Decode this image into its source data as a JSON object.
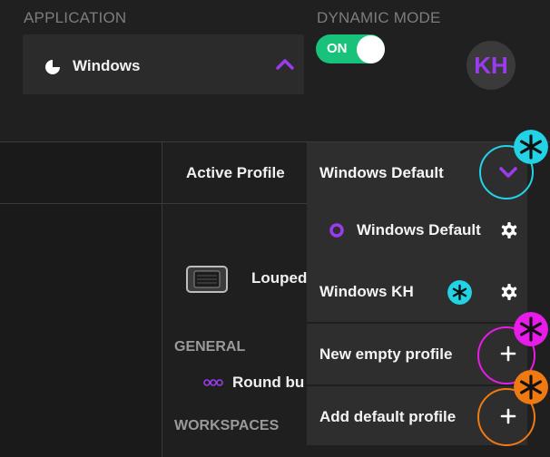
{
  "header": {
    "application_label": "APPLICATION",
    "application_value": "Windows",
    "dynamic_mode_label": "DYNAMIC MODE",
    "toggle_state": "ON",
    "avatar_initials": "KH"
  },
  "profile": {
    "label": "Active Profile",
    "selected": "Windows Default"
  },
  "background": {
    "device_label": "Louped",
    "general_label": "GENERAL",
    "round_button_label": "Round bu",
    "workspaces_label": "WORKSPACES"
  },
  "menu": {
    "items": [
      {
        "label": "Windows Default",
        "icon": "ring-icon",
        "action": "gear-icon"
      },
      {
        "label": "Windows KH",
        "action": "gear-icon"
      },
      {
        "label": "New empty profile",
        "action": "plus-icon"
      },
      {
        "label": "Add default profile",
        "action": "plus-icon"
      }
    ]
  },
  "colors": {
    "accent_purple": "#9b3bf0",
    "toggle_green": "#19c27a",
    "marker_cyan": "#22d3e6",
    "marker_magenta": "#e81ce8",
    "marker_orange": "#f07a12"
  }
}
